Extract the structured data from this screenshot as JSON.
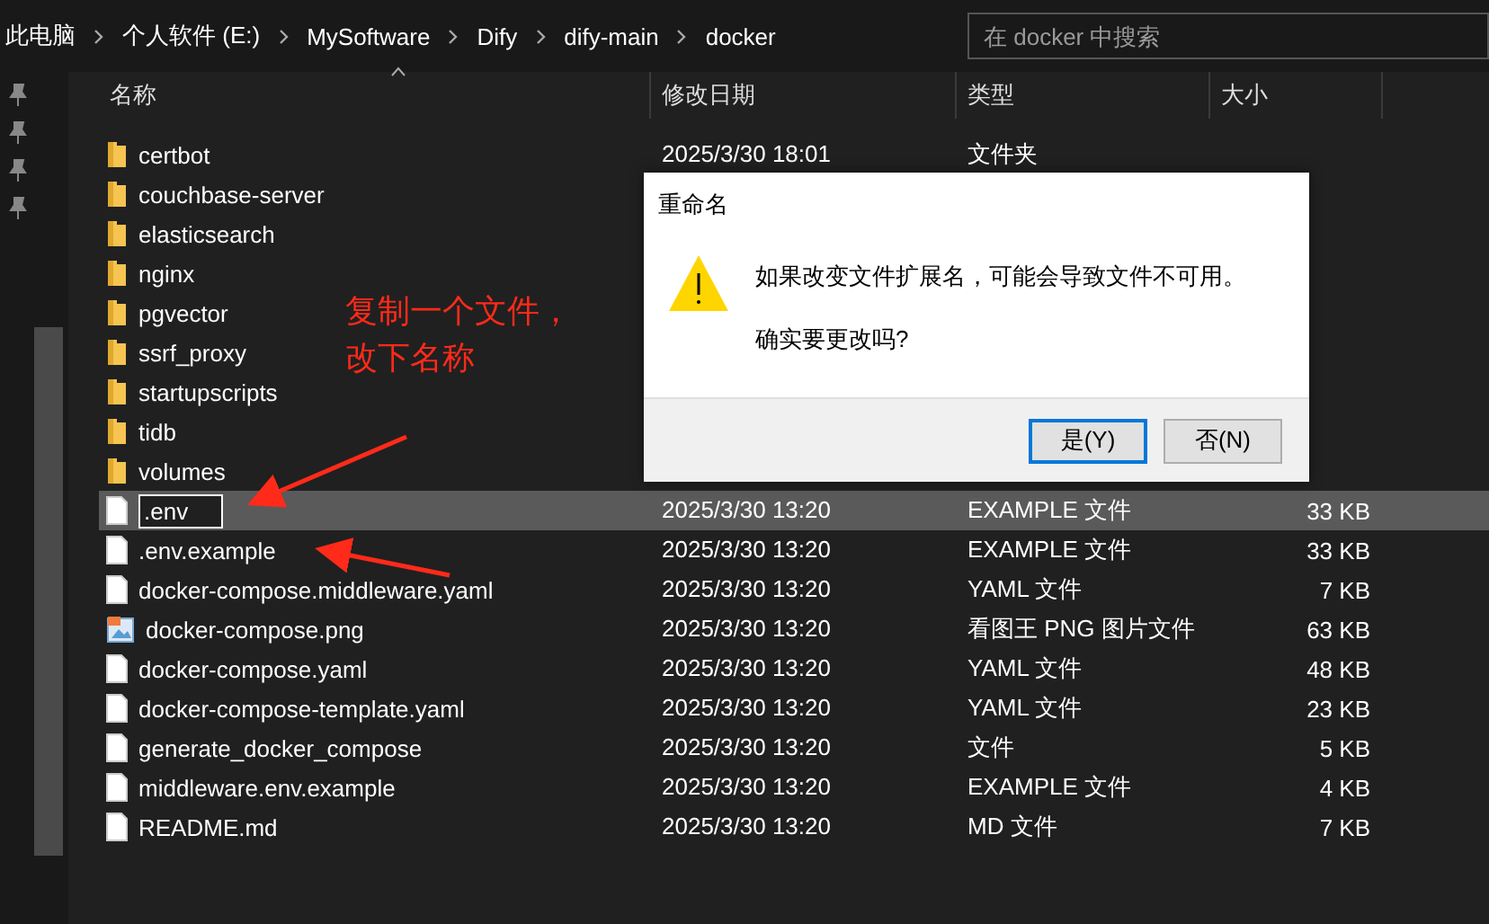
{
  "breadcrumb": [
    "此电脑",
    "个人软件 (E:)",
    "MySoftware",
    "Dify",
    "dify-main",
    "docker"
  ],
  "search": {
    "placeholder": "在 docker 中搜索"
  },
  "columns": [
    "名称",
    "修改日期",
    "类型",
    "大小"
  ],
  "files": [
    {
      "kind": "folder",
      "name": "certbot",
      "date": "2025/3/30 18:01",
      "type": "文件夹",
      "selected": false,
      "editing": false
    },
    {
      "kind": "folder",
      "name": "couchbase-server",
      "selected": false,
      "editing": false
    },
    {
      "kind": "folder",
      "name": "elasticsearch",
      "selected": false,
      "editing": false
    },
    {
      "kind": "folder",
      "name": "nginx",
      "selected": false,
      "editing": false
    },
    {
      "kind": "folder",
      "name": "pgvector",
      "selected": false,
      "editing": false
    },
    {
      "kind": "folder",
      "name": "ssrf_proxy",
      "selected": false,
      "editing": false
    },
    {
      "kind": "folder",
      "name": "startupscripts",
      "selected": false,
      "editing": false
    },
    {
      "kind": "folder",
      "name": "tidb",
      "selected": false,
      "editing": false
    },
    {
      "kind": "folder",
      "name": "volumes",
      "selected": false,
      "editing": false
    },
    {
      "kind": "file",
      "name": ".env",
      "date": "2025/3/30 13:20",
      "type": "EXAMPLE 文件",
      "size": "33 KB",
      "selected": true,
      "editing": true
    },
    {
      "kind": "file",
      "name": ".env.example",
      "date": "2025/3/30 13:20",
      "type": "EXAMPLE 文件",
      "size": "33 KB",
      "selected": false,
      "editing": false
    },
    {
      "kind": "file",
      "name": "docker-compose.middleware.yaml",
      "date": "2025/3/30 13:20",
      "type": "YAML 文件",
      "size": "7 KB",
      "selected": false,
      "editing": false
    },
    {
      "kind": "image",
      "name": "docker-compose.png",
      "date": "2025/3/30 13:20",
      "type": "看图王 PNG 图片文件",
      "size": "63 KB",
      "selected": false,
      "editing": false
    },
    {
      "kind": "file",
      "name": "docker-compose.yaml",
      "date": "2025/3/30 13:20",
      "type": "YAML 文件",
      "size": "48 KB",
      "selected": false,
      "editing": false
    },
    {
      "kind": "file",
      "name": "docker-compose-template.yaml",
      "date": "2025/3/30 13:20",
      "type": "YAML 文件",
      "size": "23 KB",
      "selected": false,
      "editing": false
    },
    {
      "kind": "file",
      "name": "generate_docker_compose",
      "date": "2025/3/30 13:20",
      "type": "文件",
      "size": "5 KB",
      "selected": false,
      "editing": false
    },
    {
      "kind": "file",
      "name": "middleware.env.example",
      "date": "2025/3/30 13:20",
      "type": "EXAMPLE 文件",
      "size": "4 KB",
      "selected": false,
      "editing": false
    },
    {
      "kind": "file",
      "name": "README.md",
      "date": "2025/3/30 13:20",
      "type": "MD 文件",
      "size": "7 KB",
      "selected": false,
      "editing": false
    }
  ],
  "annotation": {
    "text": "复制一个文件，改下名称"
  },
  "dialog": {
    "title": "重命名",
    "message": "如果改变文件扩展名，可能会导致文件不可用。",
    "question": "确实要更改吗?",
    "buttons": [
      {
        "label": "是(Y)",
        "selected": true
      },
      {
        "label": "否(N)",
        "selected": false
      }
    ]
  }
}
